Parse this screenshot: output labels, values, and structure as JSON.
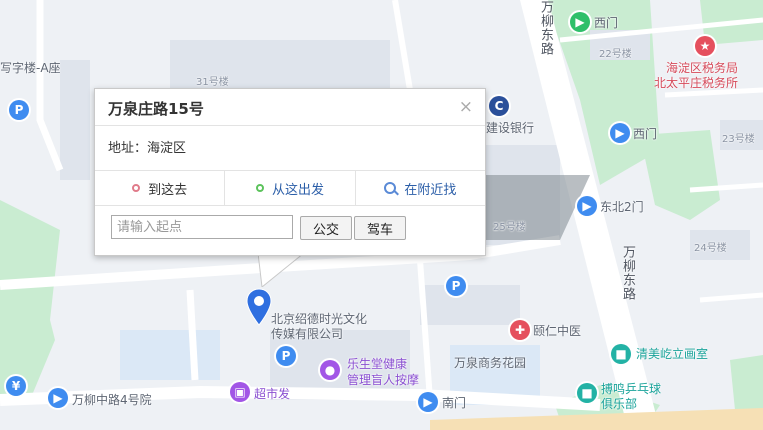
{
  "popup": {
    "title": "万泉庄路15号",
    "close": "×",
    "address": "地址：海淀区",
    "tabs": [
      {
        "label": "到这去"
      },
      {
        "label": "从这出发"
      },
      {
        "label": "在附近找"
      }
    ],
    "input_placeholder": "请输入起点",
    "btn_bus": "公交",
    "btn_drive": "驾车"
  },
  "labels": {
    "office_a": "写字楼-A座",
    "b31": "31号楼",
    "bank": "建设银行",
    "b25": "25号楼",
    "b22": "22号楼",
    "b23": "23号楼",
    "b24": "24号楼",
    "road1": "万柳东路",
    "road2": "万柳东路",
    "xi_men1": "西门",
    "xi_men2": "西门",
    "tax1": "海淀区税务局",
    "tax2": "北太平庄税务所",
    "north2": "东北2门",
    "company1": "北京绍德时光文化",
    "company2": "传媒有限公司",
    "yiren": "颐仁中医",
    "lesheng1": "乐生堂健康",
    "lesheng2": "管理盲人按摩",
    "garden": "万泉商务花园",
    "qingmei": "清美屹立画室",
    "supermarket": "超市发",
    "nanmen": "南门",
    "pingpong1": "搏鸣乒乓球",
    "pingpong2": "俱乐部",
    "wanliu4": "万柳中路4号院"
  },
  "icons": {
    "parking": "P",
    "yen": "¥"
  },
  "colors": {
    "green_area": "#c9ecd1",
    "road": "#ffffff",
    "building": "#dfe4ec",
    "water_blue": "#dbe8f6",
    "sand": "#f6e0b5"
  }
}
